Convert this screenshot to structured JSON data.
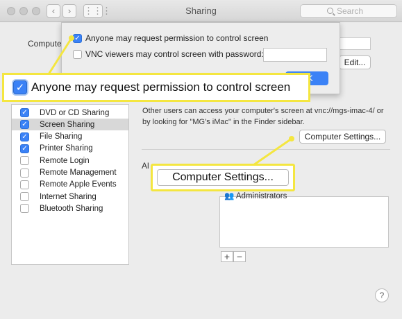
{
  "window": {
    "title": "Sharing",
    "search_placeholder": "Search",
    "computer_name_label": "Compute",
    "edit_button": "Edit..."
  },
  "sheet": {
    "option1_label": "Anyone may request permission to control screen",
    "option1_checked": true,
    "option2_label": "VNC viewers may control screen with password:",
    "option2_checked": false,
    "ok_button": "OK"
  },
  "services": [
    {
      "name": "DVD or CD Sharing",
      "checked": true
    },
    {
      "name": "Screen Sharing",
      "checked": true,
      "selected": true
    },
    {
      "name": "File Sharing",
      "checked": true
    },
    {
      "name": "Printer Sharing",
      "checked": true
    },
    {
      "name": "Remote Login",
      "checked": false
    },
    {
      "name": "Remote Management",
      "checked": false
    },
    {
      "name": "Remote Apple Events",
      "checked": false
    },
    {
      "name": "Internet Sharing",
      "checked": false
    },
    {
      "name": "Bluetooth Sharing",
      "checked": false
    }
  ],
  "main": {
    "info_text": "Other users can access your computer's screen at vnc://mgs-imac-4/ or by looking for \"MG's iMac\" in the Finder sidebar.",
    "computer_settings_button": "Computer Settings...",
    "allow_label_fragment": "Al",
    "users": [
      "Administrators"
    ],
    "add_button": "+",
    "remove_button": "−",
    "help_button": "?"
  },
  "callouts": {
    "checkbox_zoom_label": "Anyone may request permission to control screen",
    "button_zoom_label": "Computer Settings..."
  },
  "colors": {
    "accent": "#3b82f6",
    "highlight": "#f4e640"
  }
}
